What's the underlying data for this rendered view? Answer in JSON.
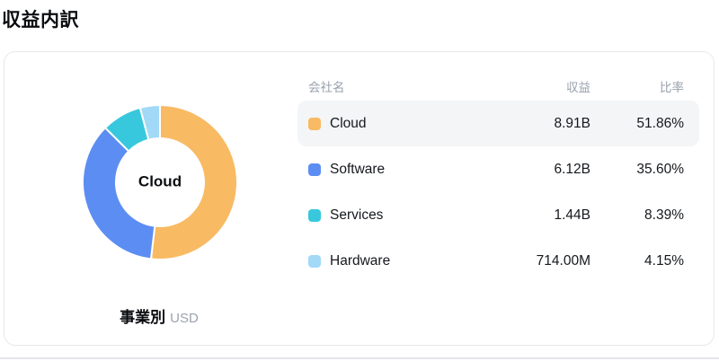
{
  "title": "収益内訳",
  "caption": {
    "label": "事業別",
    "unit": "USD"
  },
  "table": {
    "headers": [
      "会社名",
      "収益",
      "比率"
    ],
    "highlight_index": 0
  },
  "chart_data": {
    "type": "pie",
    "donut": true,
    "start_angle_deg": 0,
    "direction": "clockwise",
    "inner_radius_ratio": 0.57,
    "center_label": "Cloud",
    "series": [
      {
        "name": "Cloud",
        "revenue": "8.91B",
        "percent": 51.86,
        "ratio_label": "51.86%",
        "color": "#F8BA63"
      },
      {
        "name": "Software",
        "revenue": "6.12B",
        "percent": 35.6,
        "ratio_label": "35.60%",
        "color": "#5C8DF2"
      },
      {
        "name": "Services",
        "revenue": "1.44B",
        "percent": 8.39,
        "ratio_label": "8.39%",
        "color": "#38C8DE"
      },
      {
        "name": "Hardware",
        "revenue": "714.00M",
        "percent": 4.15,
        "ratio_label": "4.15%",
        "color": "#A1D9F7"
      }
    ]
  }
}
